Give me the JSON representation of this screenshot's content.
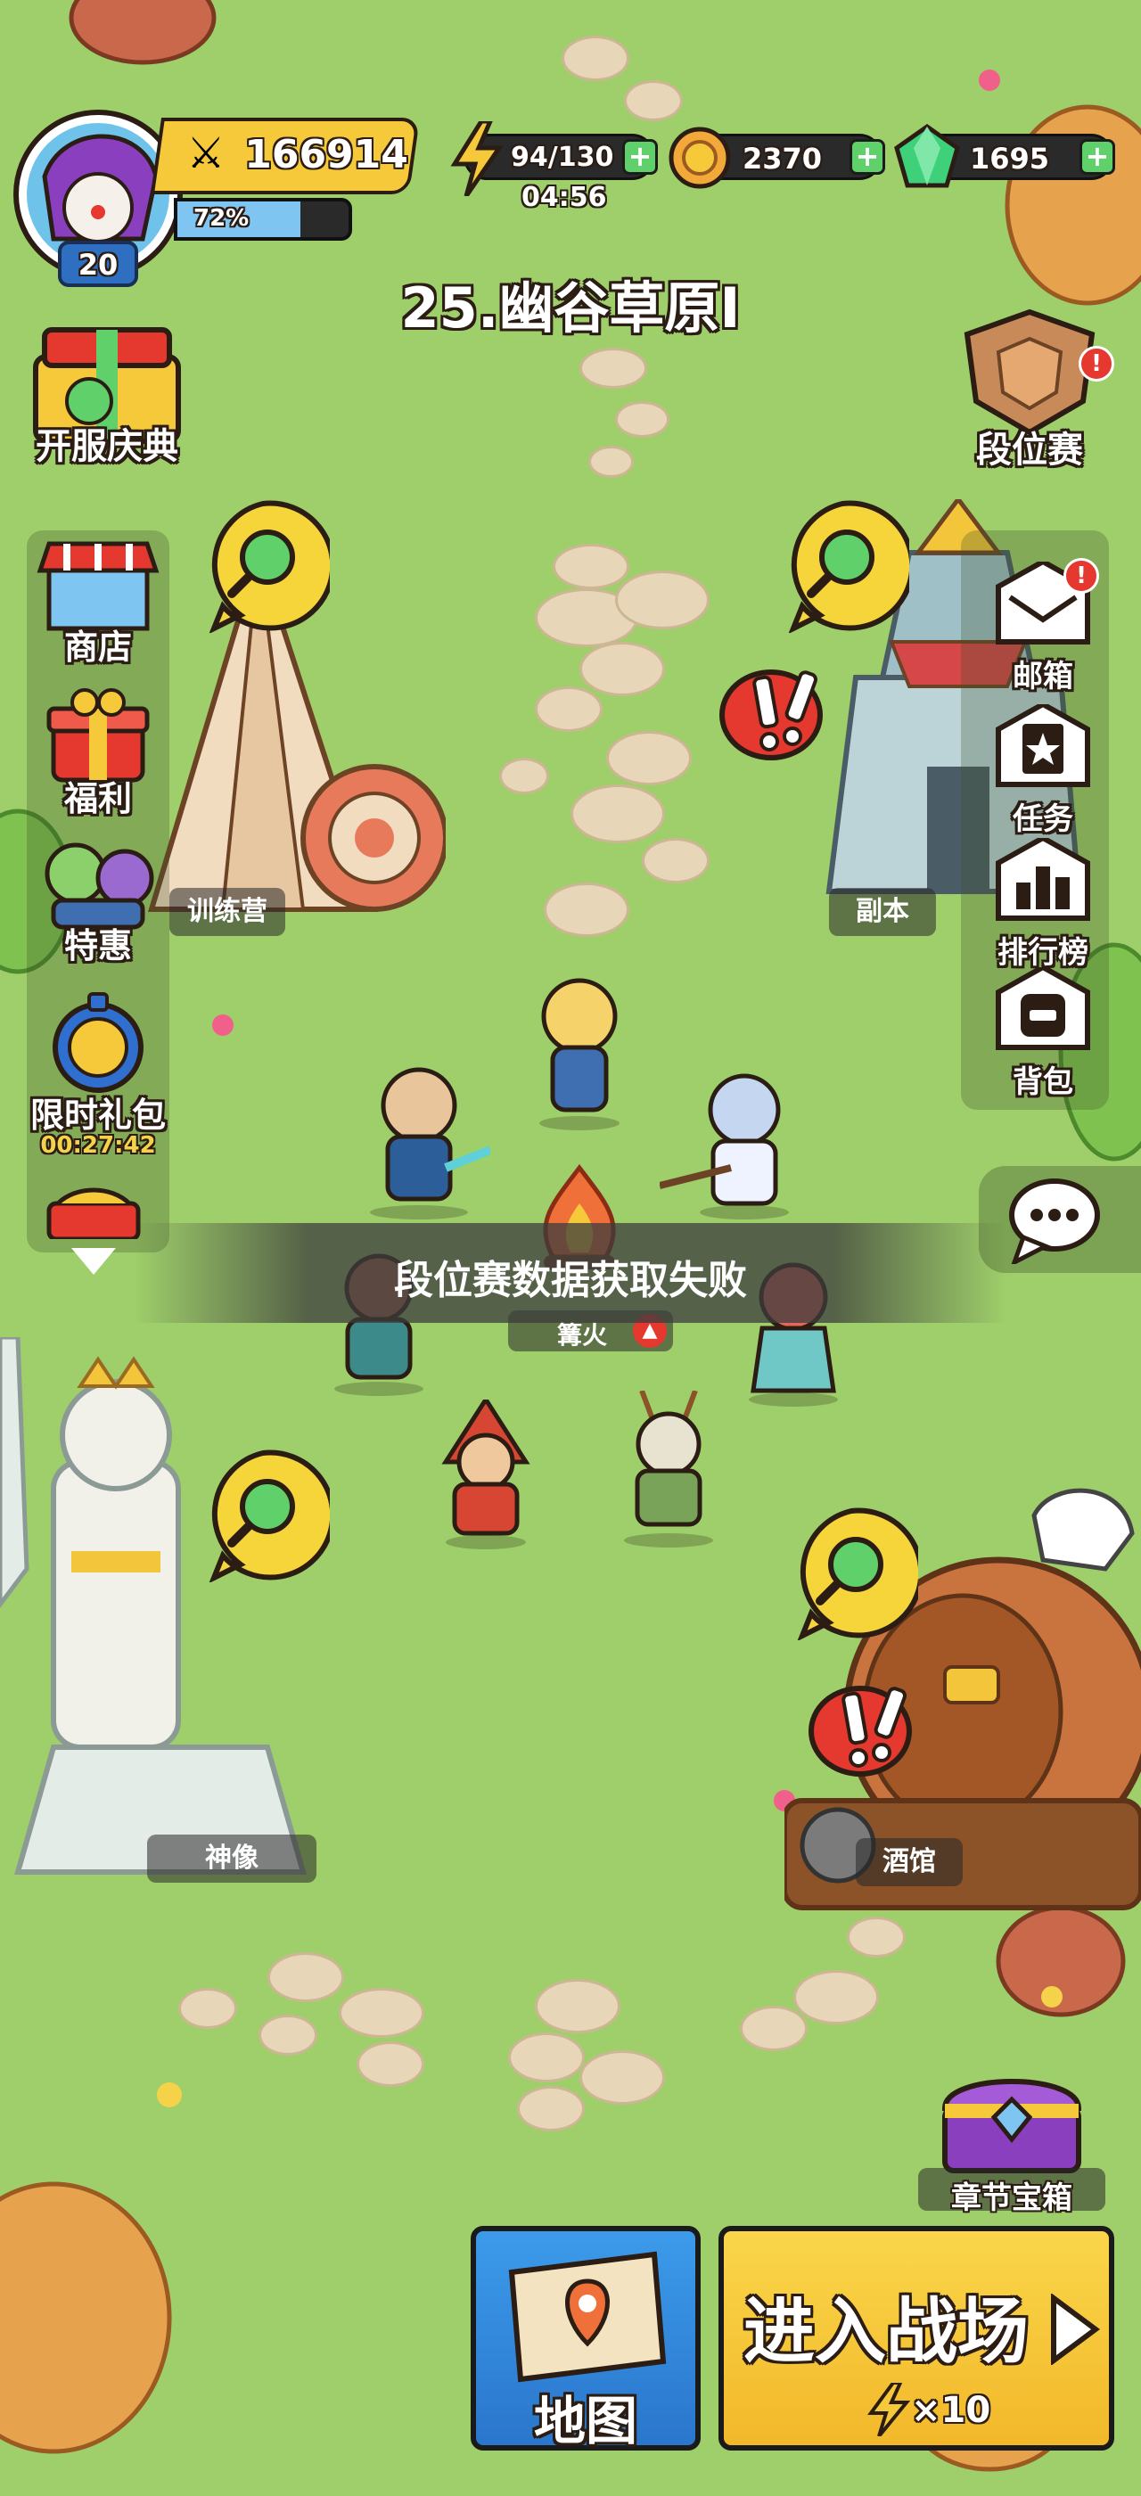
{
  "colors": {
    "grass": "#9fcf6a",
    "accent_yellow": "#f6c93a",
    "accent_blue": "#2f8be0",
    "gem_green": "#3fd07a",
    "danger_red": "#e5382f"
  },
  "player": {
    "level": "20",
    "power": "166914",
    "exp_percent": "72%",
    "exp_fraction": 0.72
  },
  "resources": {
    "energy": "94/130",
    "energy_timer": "04:56",
    "gold": "2370",
    "gems": "1695"
  },
  "stage_title": "25.幽谷草原I",
  "left_menu": {
    "festival": "开服庆典",
    "shop": "商店",
    "welfare": "福利",
    "special": "特惠",
    "limited_pack": "限时礼包",
    "limited_timer": "00:27:42"
  },
  "right_menu": {
    "ranked": "段位赛",
    "mail": "邮箱",
    "tasks": "任务",
    "leaderboard": "排行榜",
    "bag": "背包"
  },
  "buildings": {
    "training": "训练营",
    "dungeon": "副本",
    "campfire": "篝火",
    "statue": "神像",
    "tavern": "酒馆"
  },
  "toast": "段位赛数据获取失败",
  "chapter_chest": "章节宝箱",
  "map_button": "地图",
  "battle_button": "进入战场",
  "battle_cost": "×10",
  "badge_mark": "!"
}
